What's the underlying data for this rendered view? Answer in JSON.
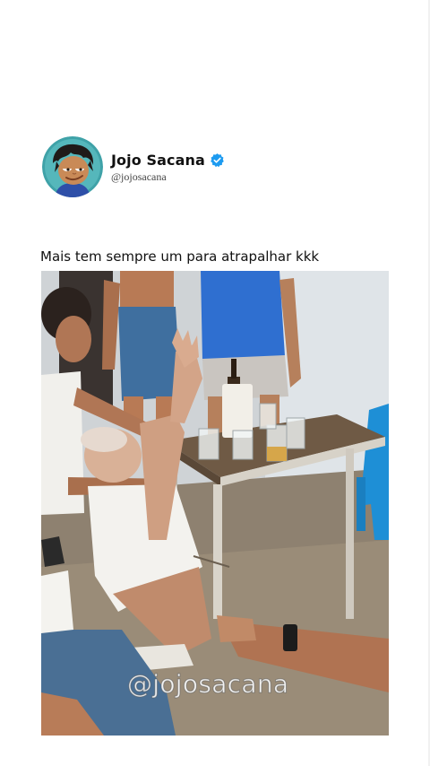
{
  "post": {
    "author": {
      "display_name": "Jojo Sacana",
      "handle": "@jojosacana",
      "verified": true,
      "avatar_icon": "cartoon-boy-avatar-icon",
      "verified_icon": "verified-badge-icon"
    },
    "caption": "Mais tem sempre um para atrapalhar kkk",
    "media": {
      "type": "video-frame",
      "watermark": "@jojosacana"
    }
  },
  "colors": {
    "background": "#ffffff",
    "text": "#111111",
    "handle": "#444444",
    "verified": "#1d9bf0",
    "avatar_bg": "#3fa2a8"
  }
}
